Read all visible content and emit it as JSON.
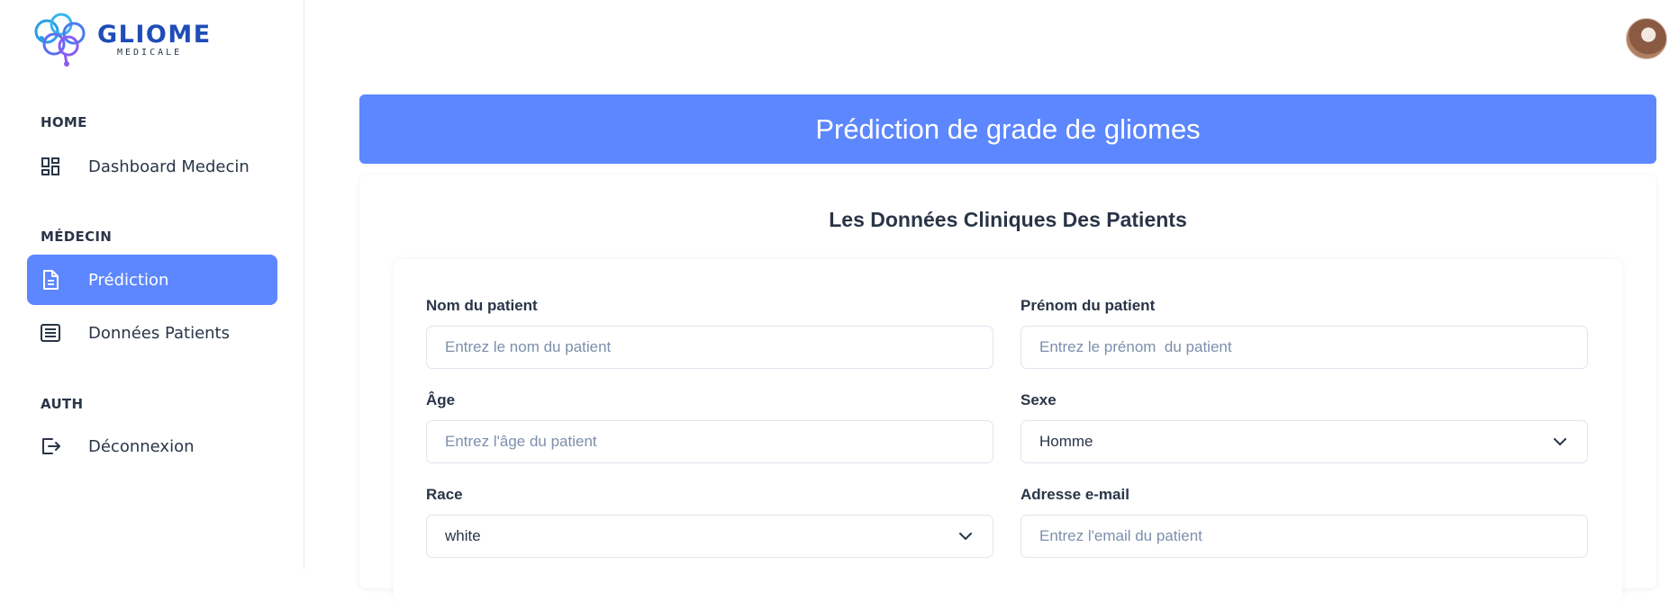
{
  "brand": {
    "name": "GLIOME",
    "subtitle": "MEDICALE"
  },
  "sidebar": {
    "sections": [
      {
        "label": "HOME"
      },
      {
        "label": "MÉDECIN"
      },
      {
        "label": "AUTH"
      }
    ],
    "items": [
      {
        "label": "Dashboard Medecin",
        "icon": "dashboard-icon"
      },
      {
        "label": "Prédiction",
        "icon": "file-text-icon",
        "active": true
      },
      {
        "label": "Données Patients",
        "icon": "list-icon"
      },
      {
        "label": "Déconnexion",
        "icon": "logout-icon"
      }
    ]
  },
  "header": {
    "avatar": "user-avatar"
  },
  "banner": {
    "title": "Prédiction de grade de gliomes"
  },
  "form": {
    "title": "Les Données Cliniques Des Patients",
    "fields": {
      "nom": {
        "label": "Nom du patient",
        "placeholder": "Entrez le nom du patient"
      },
      "prenom": {
        "label": "Prénom du patient",
        "placeholder": "Entrez le prénom  du patient"
      },
      "age": {
        "label": "Âge",
        "placeholder": "Entrez l'âge du patient"
      },
      "sexe": {
        "label": "Sexe",
        "value": "Homme"
      },
      "race": {
        "label": "Race",
        "value": "white"
      },
      "email": {
        "label": "Adresse e-mail",
        "placeholder": "Entrez l'email du patient"
      }
    }
  },
  "colors": {
    "accent": "#5d87ff",
    "text": "#2a3547",
    "placeholder": "#7c8fac",
    "border": "#dfe5ef"
  }
}
